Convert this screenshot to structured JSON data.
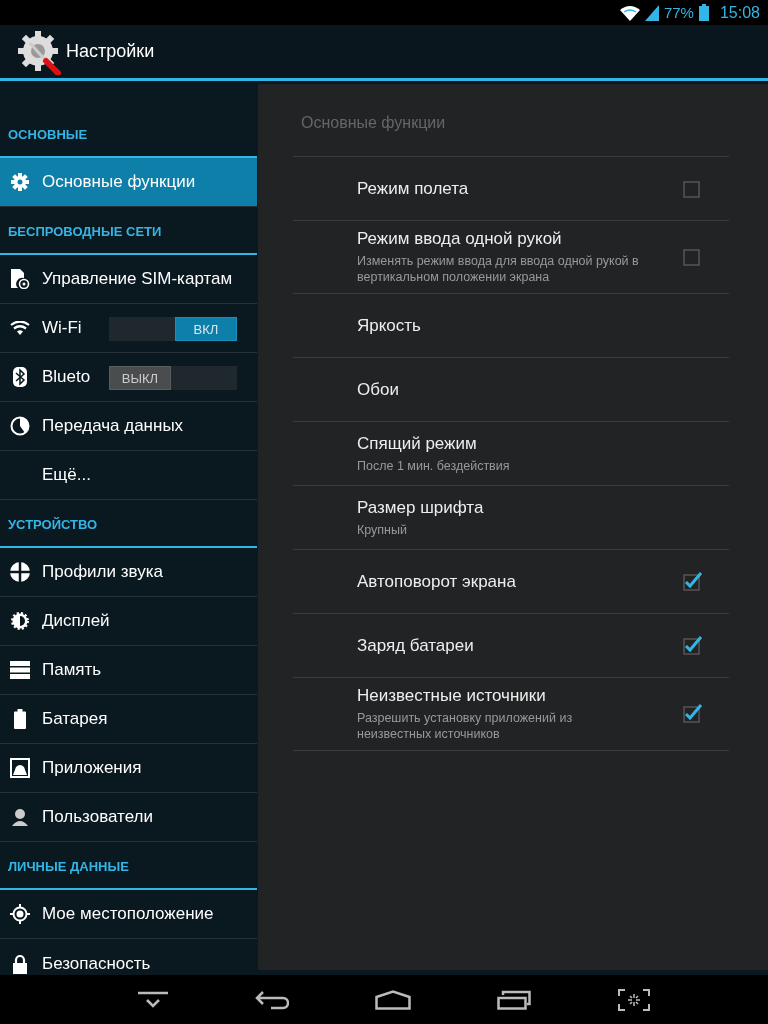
{
  "status_bar": {
    "battery": "77%",
    "time": "15:08"
  },
  "action_bar": {
    "title": "Настройки"
  },
  "sidebar": {
    "sections": [
      {
        "title": "ОСНОВНЫЕ",
        "items": [
          {
            "label": "Основные функции",
            "selected": true
          }
        ]
      },
      {
        "title": "БЕСПРОВОДНЫЕ СЕТИ",
        "items": [
          {
            "label": "Управление SIM-картам",
            "selected": false
          },
          {
            "label": "Wi-Fi",
            "selected": false,
            "toggle": {
              "label": "ВКЛ",
              "on": true
            }
          },
          {
            "label": "Blueto",
            "selected": false,
            "toggle": {
              "label": "ВЫКЛ",
              "on": false
            }
          },
          {
            "label": "Передача данных",
            "selected": false
          },
          {
            "label": "Ещё...",
            "selected": false
          }
        ]
      },
      {
        "title": "УСТРОЙСТВО",
        "items": [
          {
            "label": "Профили звука",
            "selected": false
          },
          {
            "label": "Дисплей",
            "selected": false
          },
          {
            "label": "Память",
            "selected": false
          },
          {
            "label": "Батарея",
            "selected": false
          },
          {
            "label": "Приложения",
            "selected": false
          },
          {
            "label": "Пользователи",
            "selected": false
          }
        ]
      },
      {
        "title": "ЛИЧНЫЕ ДАННЫЕ",
        "items": [
          {
            "label": "Мое местоположение",
            "selected": false
          },
          {
            "label": "Безопасность",
            "selected": false
          }
        ]
      }
    ]
  },
  "pane": {
    "title": "Основные функции",
    "items": [
      {
        "kind": "checkbox",
        "title": "Режим полета",
        "checked": false
      },
      {
        "kind": "checkbox",
        "title": "Режим ввода одной рукой",
        "summary": "Изменять режим ввода для ввода одной рукой в вертикальном положении экрана",
        "checked": false
      },
      {
        "kind": "plain",
        "title": "Яркость"
      },
      {
        "kind": "plain",
        "title": "Обои"
      },
      {
        "kind": "plain",
        "title": "Спящий режим",
        "summary": "После 1 мин. бездействия"
      },
      {
        "kind": "plain",
        "title": "Размер шрифта",
        "summary": "Крупный"
      },
      {
        "kind": "checkbox",
        "title": "Автоповорот экрана",
        "checked": true
      },
      {
        "kind": "checkbox",
        "title": "Заряд батареи",
        "checked": true
      },
      {
        "kind": "checkbox",
        "title": "Неизвестные источники",
        "summary": "Разрешить установку приложений из неизвестных источников",
        "checked": true
      }
    ]
  }
}
